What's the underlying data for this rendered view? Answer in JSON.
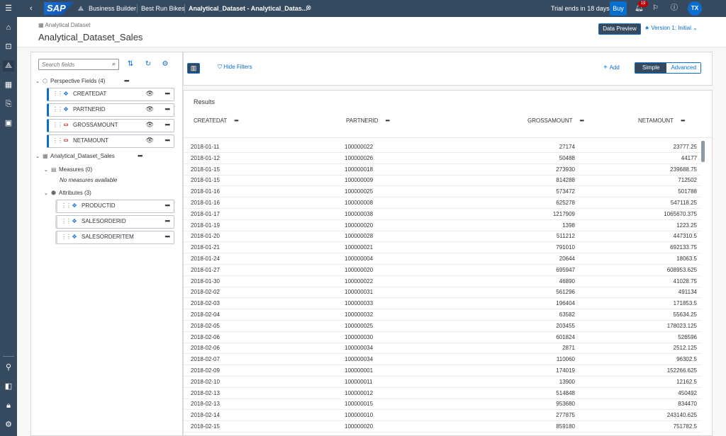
{
  "shell": {
    "nav": "Business Builder",
    "context": "Best Run Bikes",
    "tab": "Analytical_Dataset - Analytical_Datas...",
    "trial": "Trial ends in 18 days",
    "buy": "Buy",
    "notifications": "19",
    "user_initials": "TX",
    "logo": "SAP"
  },
  "header": {
    "breadcrumb": "Analytical Dataset",
    "title": "Analytical_Dataset_Sales",
    "preview_btn": "Data Preview",
    "version": "Version 1: Initial"
  },
  "left": {
    "search_placeholder": "Search fields",
    "perspective": "Perspective Fields (4)",
    "perspective_fields": [
      "CREATEDAT",
      "PARTNERID",
      "GROSSAMOUNT",
      "NETAMOUNT"
    ],
    "dataset": "Analytical_Dataset_Sales",
    "measures": "Measures (0)",
    "no_measures": "No measures available",
    "attributes": "Attributes (3)",
    "attribute_fields": [
      "PRODUCTID",
      "SALESORDERID",
      "SALESORDERITEM"
    ]
  },
  "toolbar": {
    "hide_filters": "Hide Filters",
    "add": "Add",
    "simple": "Simple",
    "advanced": "Advanced"
  },
  "results": {
    "title": "Results",
    "columns": [
      "CREATEDAT",
      "PARTNERID",
      "GROSSAMOUNT",
      "NETAMOUNT"
    ],
    "rows": [
      [
        "2018-01-11",
        "100000022",
        "27174",
        "23777.25"
      ],
      [
        "2018-01-12",
        "100000026",
        "50488",
        "44177"
      ],
      [
        "2018-01-15",
        "100000018",
        "273930",
        "239688.75"
      ],
      [
        "2018-01-15",
        "100000009",
        "814288",
        "712502"
      ],
      [
        "2018-01-16",
        "100000025",
        "573472",
        "501788"
      ],
      [
        "2018-01-16",
        "100000008",
        "625278",
        "547118.25"
      ],
      [
        "2018-01-17",
        "100000038",
        "1217909",
        "1065670.375"
      ],
      [
        "2018-01-19",
        "100000020",
        "1398",
        "1223.25"
      ],
      [
        "2018-01-20",
        "100000028",
        "511212",
        "447310.5"
      ],
      [
        "2018-01-21",
        "100000021",
        "791010",
        "692133.75"
      ],
      [
        "2018-01-24",
        "100000004",
        "20644",
        "18063.5"
      ],
      [
        "2018-01-27",
        "100000020",
        "695947",
        "608953.625"
      ],
      [
        "2018-01-30",
        "100000022",
        "46890",
        "41028.75"
      ],
      [
        "2018-02-02",
        "100000031",
        "561296",
        "491134"
      ],
      [
        "2018-02-03",
        "100000033",
        "196404",
        "171853.5"
      ],
      [
        "2018-02-04",
        "100000032",
        "63582",
        "55634.25"
      ],
      [
        "2018-02-05",
        "100000025",
        "203455",
        "178023.125"
      ],
      [
        "2018-02-06",
        "100000030",
        "601824",
        "526596"
      ],
      [
        "2018-02-06",
        "100000034",
        "2871",
        "2512.125"
      ],
      [
        "2018-02-07",
        "100000034",
        "110060",
        "96302.5"
      ],
      [
        "2018-02-09",
        "100000001",
        "174019",
        "152266.625"
      ],
      [
        "2018-02-10",
        "100000011",
        "13900",
        "12162.5"
      ],
      [
        "2018-02-13",
        "100000012",
        "514848",
        "450492"
      ],
      [
        "2018-02-13",
        "100000015",
        "953680",
        "834470"
      ],
      [
        "2018-02-14",
        "100000010",
        "277875",
        "243140.625"
      ],
      [
        "2018-02-15",
        "100000020",
        "859180",
        "751782.5"
      ]
    ]
  },
  "colors": {
    "shell": "#354a5f",
    "accent": "#0a6ed1"
  }
}
